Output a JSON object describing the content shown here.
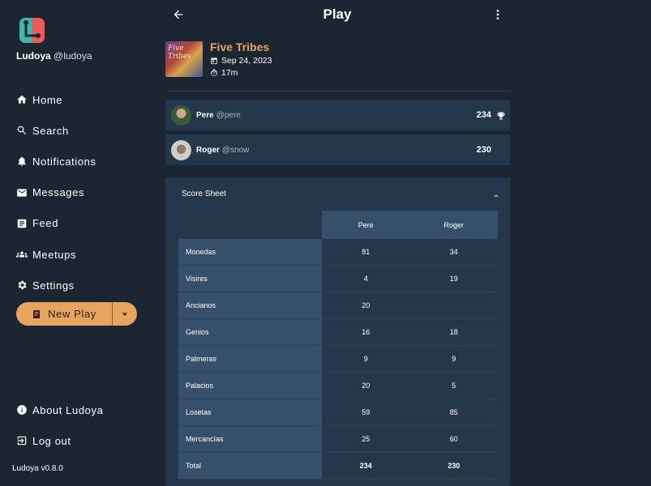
{
  "app": {
    "brand_name": "Ludoya",
    "brand_handle": "@ludoya",
    "version": "Ludoya v0.8.0",
    "accent_color": "#e6a45e",
    "background_color": "#1c2632"
  },
  "sidebar": {
    "items": [
      {
        "label": "Home",
        "icon": "home-icon"
      },
      {
        "label": "Search",
        "icon": "search-icon"
      },
      {
        "label": "Notifications",
        "icon": "bell-icon"
      },
      {
        "label": "Messages",
        "icon": "mail-icon"
      },
      {
        "label": "Feed",
        "icon": "document-icon"
      },
      {
        "label": "Meetups",
        "icon": "people-icon"
      },
      {
        "label": "Settings",
        "icon": "gear-icon"
      }
    ],
    "new_play_label": "New Play",
    "bottom_items": [
      {
        "label": "About Ludoya",
        "icon": "info-icon"
      },
      {
        "label": "Log out",
        "icon": "logout-icon"
      }
    ]
  },
  "header": {
    "title": "Play"
  },
  "game": {
    "name": "Five Tribes",
    "cover_text": "Five Tribes",
    "date": "Sep 24, 2023",
    "duration": "17m"
  },
  "players": [
    {
      "name": "Pere",
      "handle": "@pere",
      "score": "234",
      "winner": true
    },
    {
      "name": "Roger",
      "handle": "@snow",
      "score": "230",
      "winner": false
    }
  ],
  "score_sheet": {
    "title": "Score Sheet",
    "columns": [
      "Pere",
      "Roger"
    ],
    "rows": [
      {
        "label": "Monedas",
        "values": [
          "81",
          "34"
        ]
      },
      {
        "label": "Visires",
        "values": [
          "4",
          "19"
        ]
      },
      {
        "label": "Ancianos",
        "values": [
          "20",
          ""
        ]
      },
      {
        "label": "Genios",
        "values": [
          "16",
          "18"
        ]
      },
      {
        "label": "Palmeras",
        "values": [
          "9",
          "9"
        ]
      },
      {
        "label": "Palacios",
        "values": [
          "20",
          "5"
        ]
      },
      {
        "label": "Losetas",
        "values": [
          "59",
          "85"
        ]
      },
      {
        "label": "Mercancías",
        "values": [
          "25",
          "60"
        ]
      },
      {
        "label": "Total",
        "values": [
          "234",
          "230"
        ]
      }
    ]
  }
}
